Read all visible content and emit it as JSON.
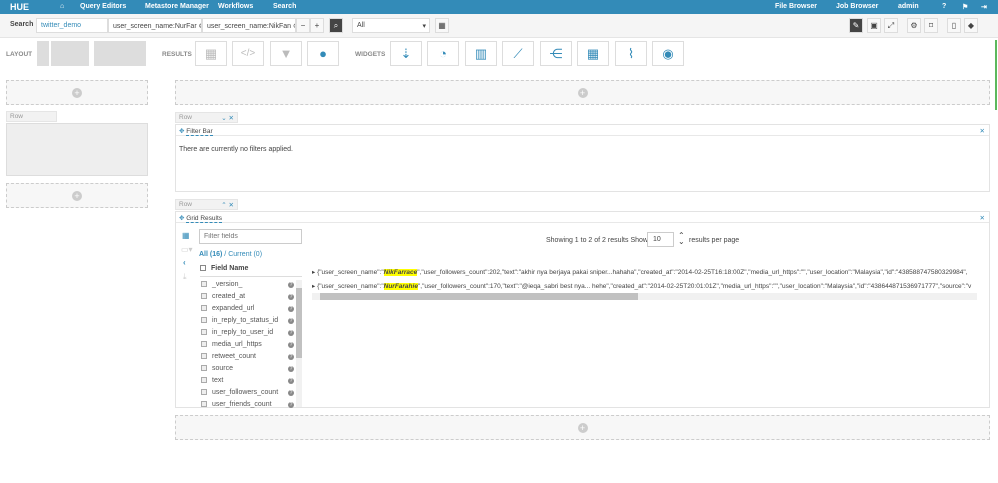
{
  "nav": {
    "logo": "HUE",
    "items": [
      "Query Editors",
      "Metastore Manager",
      "Workflows",
      "Search"
    ],
    "right": [
      "File Browser",
      "Job Browser",
      "admin"
    ]
  },
  "search": {
    "label": "Search",
    "collection": "twitter_demo",
    "filters": [
      "user_screen_name:NurFar",
      "user_screen_name:NikFan"
    ],
    "select": "All"
  },
  "toolbar": {
    "layout": "LAYOUT",
    "results": "RESULTS",
    "widgets": "WIDGETS"
  },
  "left_row": {
    "label": "Row"
  },
  "filter_row": {
    "label": "Row",
    "title": "Filter Bar",
    "message": "There are currently no filters applied."
  },
  "grid_row": {
    "label": "Row",
    "title": "Grid Results",
    "filter_placeholder": "Filter fields",
    "all": "All (16)",
    "sep": " / ",
    "current": "Current (0)",
    "field_header": "Field Name",
    "fields": [
      "_version_",
      "created_at",
      "expanded_url",
      "in_reply_to_status_id",
      "in_reply_to_user_id",
      "media_url_https",
      "retweet_count",
      "source",
      "text",
      "user_followers_count",
      "user_friends_count"
    ],
    "showing": "Showing 1 to 2 of 2 results Show",
    "page_size": "10",
    "per_page": "results per page",
    "records": [
      {
        "pre": "{\"user_screen_name\":\"",
        "name": "NikFarrace",
        "post": "\",\"user_followers_count\":202,\"text\":\"akhir nya berjaya pakai sniper...hahaha\",\"created_at\":\"2014-02-25T16:18:00Z\",\"media_url_https\":\"\",\"user_location\":\"Malaysia\",\"id\":\"438588747580329984\","
      },
      {
        "pre": "{\"user_screen_name\":\"",
        "name": "NurFarahie",
        "post": "\",\"user_followers_count\":170,\"text\":\"@ieqa_sabri best nya... hehe\",\"created_at\":\"2014-02-25T20:01:01Z\",\"media_url_https\":\"\",\"user_location\":\"Malaysia\",\"id\":\"438644871536971777\",\"source\":\"v"
      }
    ]
  }
}
